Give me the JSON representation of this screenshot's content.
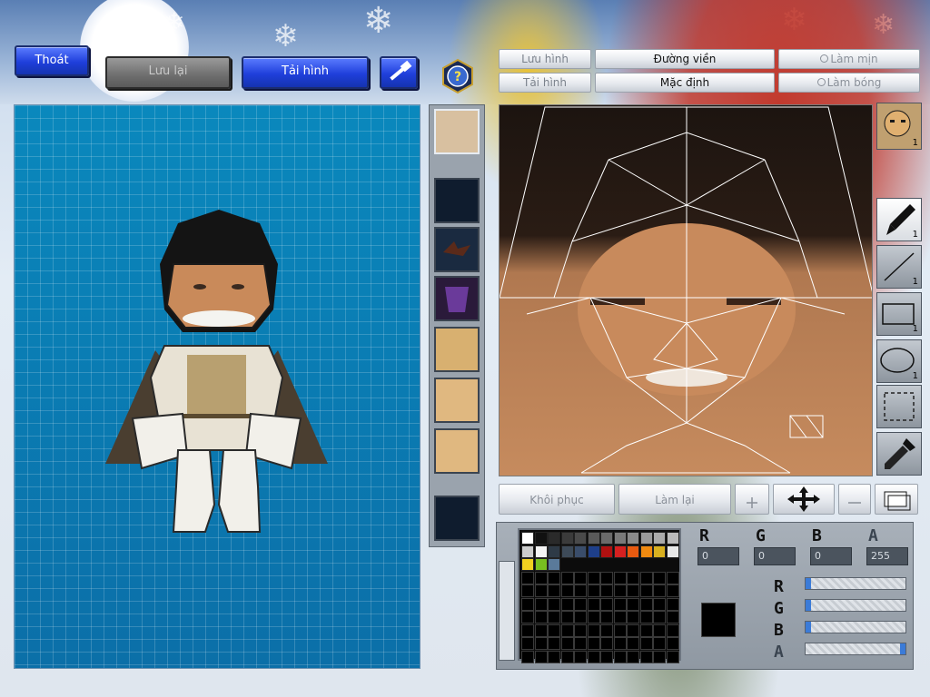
{
  "top_left_buttons": {
    "exit": "Thoát",
    "save": "Lưu lại",
    "reload": "Tải hình"
  },
  "face_toolbar": {
    "save_image": "Lưu hình",
    "load_image": "Tải hình",
    "outline": "Đường viền",
    "default": "Mặc định",
    "smooth": "Làm mịn",
    "shade": "Làm bóng"
  },
  "tools": {
    "portrait_count": "1",
    "brush_count": "1",
    "line_count": "1",
    "rect_count": "1",
    "ellipse_count": "1"
  },
  "edit_bar": {
    "restore": "Khôi phục",
    "redo": "Làm lại"
  },
  "color": {
    "r_value": "0",
    "g_value": "0",
    "b_value": "0",
    "a_value": "255",
    "r_label": "R",
    "g_label": "G",
    "b_label": "B",
    "a_label": "A",
    "current_color": "#000000",
    "sliders": {
      "r": 0,
      "g": 0,
      "b": 0,
      "a": 255
    },
    "palette_row1": [
      "#ffffff",
      "#111111",
      "#2a2a2a",
      "#3b3b3b",
      "#4a4a4a",
      "#5a5a5a",
      "#6a6a6a",
      "#7a7a7a",
      "#8a8a8a",
      "#9a9a9a",
      "#aaaaaa",
      "#bbbbbb"
    ],
    "palette_row2": [
      "#cccccc",
      "#f5f5f5",
      "#2e3a46",
      "#3d4a58",
      "#3a4d6a",
      "#1e3f8a",
      "#b01010",
      "#d62020",
      "#e85a10",
      "#f08a10",
      "#d8b020",
      "#e8e8e8"
    ],
    "palette_row3": [
      "#f0d020",
      "#78c020",
      "#5a7a9a"
    ]
  }
}
